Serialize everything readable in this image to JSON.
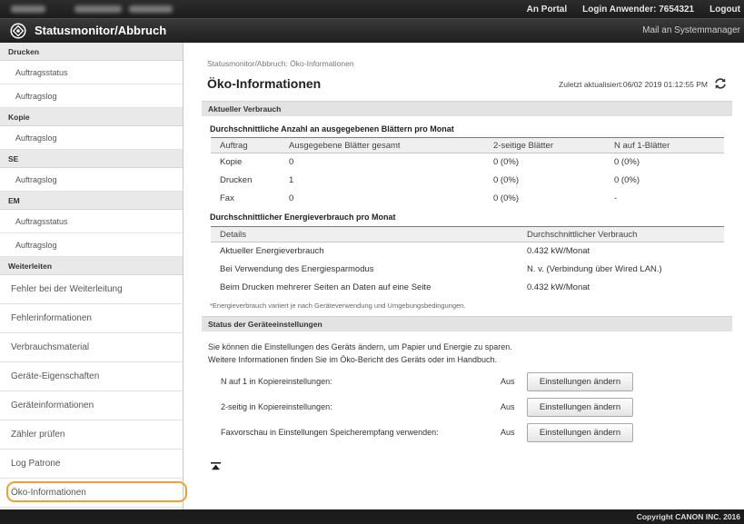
{
  "colors": {
    "highlight": "#f0a033",
    "bar": "#1c1c1c",
    "section": "#e3e3e3"
  },
  "topbar": {
    "portal_link": "An Portal",
    "login_label": "Login Anwender: 7654321",
    "logout_link": "Logout"
  },
  "header": {
    "icon": "status-monitor-icon",
    "title": "Statusmonitor/Abbruch",
    "mail_link": "Mail an Systemmanager"
  },
  "sidebar": {
    "groups": [
      {
        "label": "Drucken",
        "items": [
          "Auftragsstatus",
          "Auftragslog"
        ]
      },
      {
        "label": "Kopie",
        "items": [
          "Auftragslog"
        ]
      },
      {
        "label": "SE",
        "items": [
          "Auftragslog"
        ]
      },
      {
        "label": "EM",
        "items": [
          "Auftragsstatus",
          "Auftragslog"
        ]
      },
      {
        "label": "Weiterleiten",
        "items": [
          "Fehler bei der Weiterleitung"
        ]
      }
    ],
    "links": [
      {
        "label": "Fehlerinformationen",
        "active": false
      },
      {
        "label": "Verbrauchsmaterial",
        "active": false
      },
      {
        "label": "Geräte-Eigenschaften",
        "active": false
      },
      {
        "label": "Geräteinformationen",
        "active": false
      },
      {
        "label": "Zähler prüfen",
        "active": false
      },
      {
        "label": "Log Patrone",
        "active": false
      },
      {
        "label": "Öko-Informationen",
        "active": true
      }
    ]
  },
  "main": {
    "breadcrumb": "Statusmonitor/Abbruch: Öko-Informationen",
    "title": "Öko-Informationen",
    "last_updated": "Zuletzt aktualisiert:06/02 2019 01:12:55 PM",
    "refresh_icon": "refresh-icon",
    "consumption": {
      "section_title": "Aktueller Verbrauch",
      "sheets": {
        "title": "Durchschnittliche Anzahl an ausgegebenen Blättern pro Monat",
        "columns": [
          "Auftrag",
          "Ausgegebene Blätter gesamt",
          "2-seitige Blätter",
          "N auf 1-Blätter"
        ],
        "rows": [
          [
            "Kopie",
            "0",
            "0 (0%)",
            "0 (0%)"
          ],
          [
            "Drucken",
            "1",
            "0 (0%)",
            "0 (0%)"
          ],
          [
            "Fax",
            "0",
            "0 (0%)",
            "-"
          ]
        ]
      },
      "energy": {
        "title": "Durchschnittlicher Energieverbrauch pro Monat",
        "columns": [
          "Details",
          "Durchschnittlicher Verbrauch"
        ],
        "rows": [
          [
            "Aktueller Energieverbrauch",
            "0.432 kW/Monat"
          ],
          [
            "Bei Verwendung des Energiesparmodus",
            "N. v. (Verbindung über Wired LAN.)"
          ],
          [
            "Beim Drucken mehrerer Seiten an Daten auf eine Seite",
            "0.432 kW/Monat"
          ]
        ]
      },
      "note": "*Energieverbrauch variiert je nach Geräteverwendung und Umgebungsbedingungen."
    },
    "settings": {
      "section_title": "Status der Geräteeinstellungen",
      "intro": [
        "Sie können die Einstellungen des Geräts ändern, um Papier und Energie zu sparen.",
        "Weitere Informationen finden Sie im Öko-Bericht des Geräts oder im Handbuch."
      ],
      "rows": [
        {
          "label": "N auf 1 in Kopiereinstellungen:",
          "value": "Aus",
          "button": "Einstellungen ändern"
        },
        {
          "label": "2-seitig in Kopiereinstellungen:",
          "value": "Aus",
          "button": "Einstellungen ändern"
        },
        {
          "label": "Faxvorschau in Einstellungen Speicherempfang verwenden:",
          "value": "Aus",
          "button": "Einstellungen ändern"
        }
      ]
    },
    "back_to_top_icon": "back-to-top-icon"
  },
  "footer": {
    "copyright": "Copyright CANON INC. 2016"
  }
}
